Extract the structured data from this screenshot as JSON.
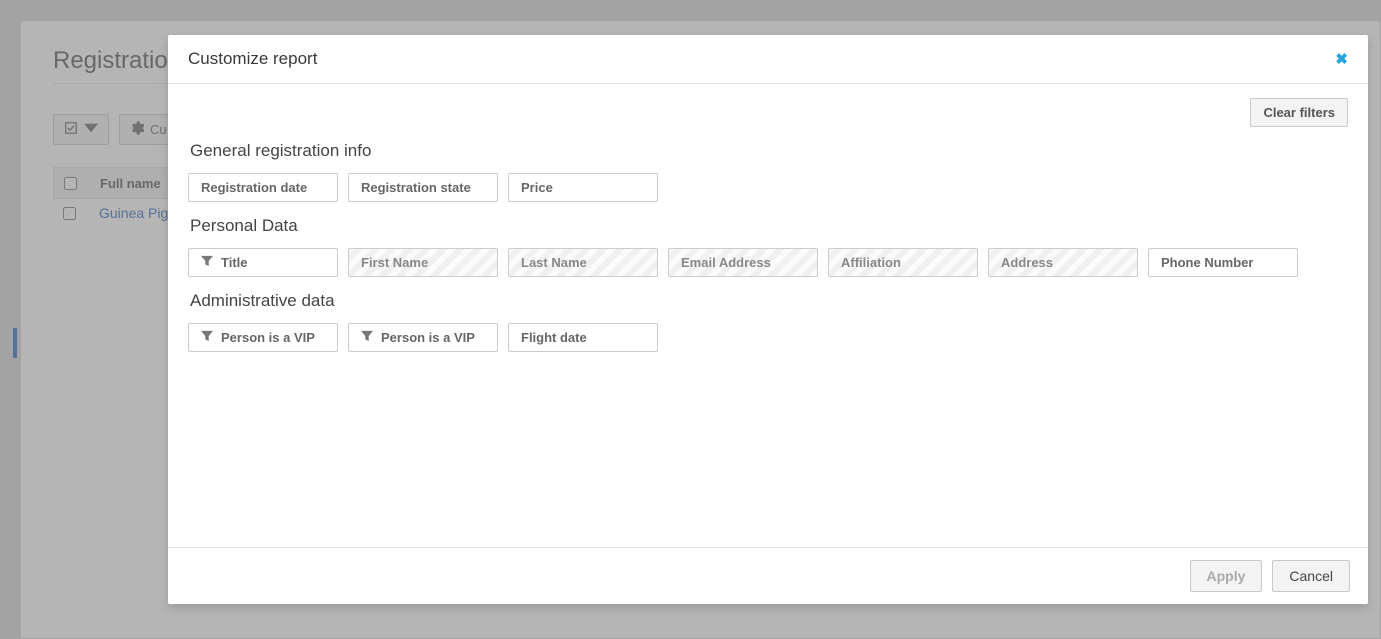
{
  "page": {
    "title": "Registrations",
    "toolbar": {
      "customize_label": "Cu"
    },
    "table": {
      "columns": [
        "Full name"
      ],
      "rows": [
        {
          "full_name": "Guinea Pig"
        }
      ]
    }
  },
  "modal": {
    "title": "Customize report",
    "clear_filters_label": "Clear filters",
    "sections": [
      {
        "title": "General registration info",
        "pills": [
          {
            "label": "Registration date",
            "filter": false,
            "disabled": false
          },
          {
            "label": "Registration state",
            "filter": false,
            "disabled": false
          },
          {
            "label": "Price",
            "filter": false,
            "disabled": false
          }
        ]
      },
      {
        "title": "Personal Data",
        "pills": [
          {
            "label": "Title",
            "filter": true,
            "disabled": false
          },
          {
            "label": "First Name",
            "filter": false,
            "disabled": true
          },
          {
            "label": "Last Name",
            "filter": false,
            "disabled": true
          },
          {
            "label": "Email Address",
            "filter": false,
            "disabled": true
          },
          {
            "label": "Affiliation",
            "filter": false,
            "disabled": true
          },
          {
            "label": "Address",
            "filter": false,
            "disabled": true
          },
          {
            "label": "Phone Number",
            "filter": false,
            "disabled": false
          }
        ]
      },
      {
        "title": "Administrative data",
        "pills": [
          {
            "label": "Person is a VIP",
            "filter": true,
            "disabled": false
          },
          {
            "label": "Person is a VIP",
            "filter": true,
            "disabled": false
          },
          {
            "label": "Flight date",
            "filter": false,
            "disabled": false
          }
        ]
      }
    ],
    "footer": {
      "apply_label": "Apply",
      "cancel_label": "Cancel"
    }
  }
}
